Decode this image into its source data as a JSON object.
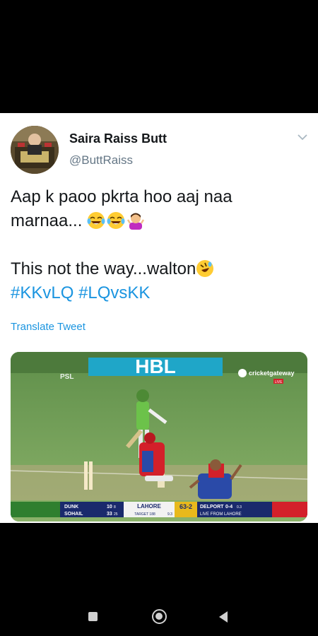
{
  "tweet": {
    "author_name": "Saira Raiss Butt",
    "author_handle": "@ButtRaiss",
    "line1": "Aap k paoo pkrta hoo aaj naa",
    "line2": "marnaa...",
    "line3": "This not the way...walton",
    "hashtag1": "#KKvLQ",
    "hashtag2": "#LQvsKK",
    "translate_label": "Translate Tweet",
    "emojis": [
      "face-with-tears-of-joy",
      "face-with-tears-of-joy",
      "person-shrugging",
      "rolling-on-floor-laughing"
    ]
  },
  "media": {
    "broadcaster": "cricketgateway",
    "live_tag": "LIVE",
    "scorebar": {
      "batter1": "DUNK",
      "batter1_score": "10",
      "batter1_balls": "8",
      "batter2": "SOHAIL",
      "batter2_score": "33",
      "batter2_balls": "25",
      "team": "LAHORE",
      "score": "63-2",
      "target": "TARGET 188",
      "overs": "9.3",
      "bowler": "DELPORT",
      "bowler_figures": "0-4",
      "bowler_overs": "0.3",
      "live_from": "LIVE FROM LAHORE"
    }
  },
  "colors": {
    "hashtag": "#1b95e0",
    "name": "#14171a",
    "handle": "#657786",
    "pitch_green": "#7aa35e",
    "scorebar_navy": "#1a2a6c",
    "scorebar_red": "#d3202a"
  }
}
